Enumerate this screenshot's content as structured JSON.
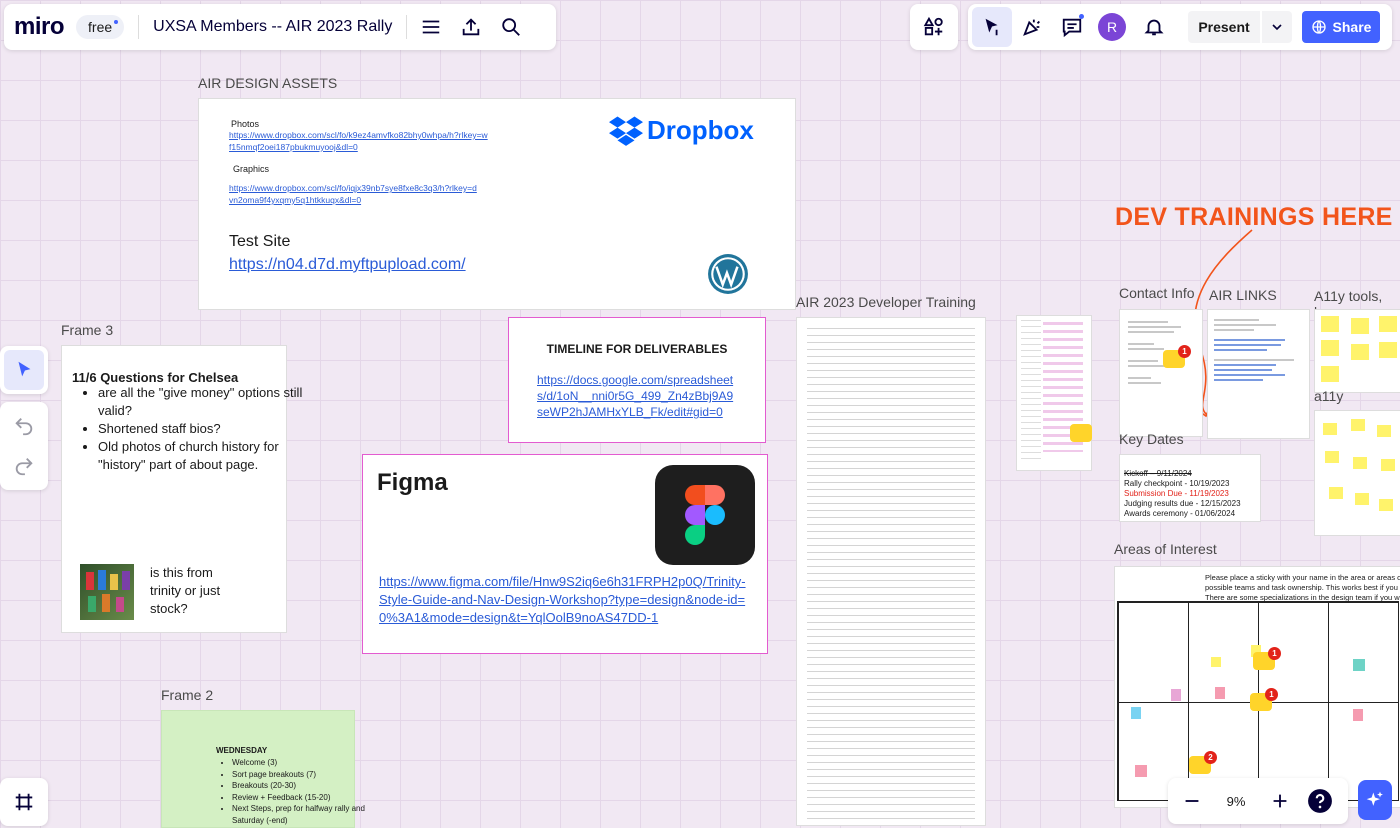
{
  "brand": {
    "logo": "miro",
    "plan": "free"
  },
  "board": {
    "title": "UXSA Members -- AIR 2023 Rally"
  },
  "toolbar_right": {
    "avatar_initial": "R",
    "present_label": "Present",
    "share_label": "Share"
  },
  "design_assets": {
    "frame_title": "AIR DESIGN ASSETS",
    "photos_label": "Photos",
    "photos_link": "https://www.dropbox.com/scl/fo/k9ez4amvfko82bhy0whpa/h?rlkey=wf15nmqf2oei187pbukmuyooj&dl=0",
    "graphics_label": "Graphics",
    "graphics_link": "https://www.dropbox.com/scl/fo/iqjx39nb7sye8fxe8c3q3/h?rlkey=dvn2oma9f4yxqmy5q1htkkuqx&dl=0",
    "dropbox_brand": "Dropbox",
    "test_site_label": "Test Site",
    "test_site_link": "https://n04.d7d.myftpupload.com/"
  },
  "timeline": {
    "title": "TIMELINE FOR DELIVERABLES",
    "link": "https://docs.google.com/spreadsheets/d/1oN__nni0r5G_499_Zn4zBbj9A9seWP2hJAMHxYLB_Fk/edit#gid=0"
  },
  "figma": {
    "title": "Figma",
    "link": "https://www.figma.com/file/Hnw9S2iq6e6h31FRPH2p0Q/Trinity-Style-Guide-and-Nav-Design-Workshop?type=design&node-id=0%3A1&mode=design&t=YqlOolB9noAS47DD-1"
  },
  "frame3": {
    "frame_title": "Frame 3",
    "heading": "11/6 Questions for Chelsea",
    "bullets": [
      "are all the \"give money\" options still valid?",
      "Shortened staff bios?",
      "Old photos of church history for \"history\" part of about page."
    ],
    "photo_caption": "is this from trinity or just stock?"
  },
  "frame2": {
    "frame_title": "Frame 2",
    "heading": "WEDNESDAY",
    "items": [
      "Welcome (3)",
      "Sort page breakouts (7)",
      "Breakouts (20-30)",
      "Review + Feedback (15-20)",
      "Next Steps, prep for halfway rally and Saturday (-end)"
    ]
  },
  "dev_training": {
    "frame_title": "AIR 2023 Developer Training"
  },
  "annotation": {
    "text": "DEV TRAININGS HERE",
    "color": "#f2541b"
  },
  "contact_info": {
    "frame_title": "Contact Info",
    "badge": "1"
  },
  "air_links": {
    "frame_title": "AIR LINKS"
  },
  "a11y_tools": {
    "frame_title": "A11y tools, l..."
  },
  "a11y": {
    "frame_title": "a11y"
  },
  "key_dates": {
    "frame_title": "Key Dates",
    "lines": [
      {
        "text": "Kickoff – 9/11/2024",
        "style": "strike"
      },
      {
        "text": "Rally checkpoint - 10/19/2023",
        "style": "normal"
      },
      {
        "text": "Submission Due - 11/19/2023",
        "style": "red"
      },
      {
        "text": "Judging results due - 12/15/2023",
        "style": "normal"
      },
      {
        "text": "Awards ceremony - 01/06/2024",
        "style": "normal"
      }
    ]
  },
  "areas": {
    "frame_title": "Areas of Interest",
    "intro_lines": [
      "Please place a sticky with your name in the area or areas of interest. We can",
      "possible teams and task ownership. This works best if you indicate the top 2",
      "There are some specializations in the design team if you would like to identify"
    ],
    "badges": [
      "1",
      "1",
      "2"
    ]
  },
  "zoom": {
    "level": "9%"
  },
  "colors": {
    "accent": "#4262ff",
    "brand_dark": "#050038",
    "annotation": "#f2541b"
  }
}
